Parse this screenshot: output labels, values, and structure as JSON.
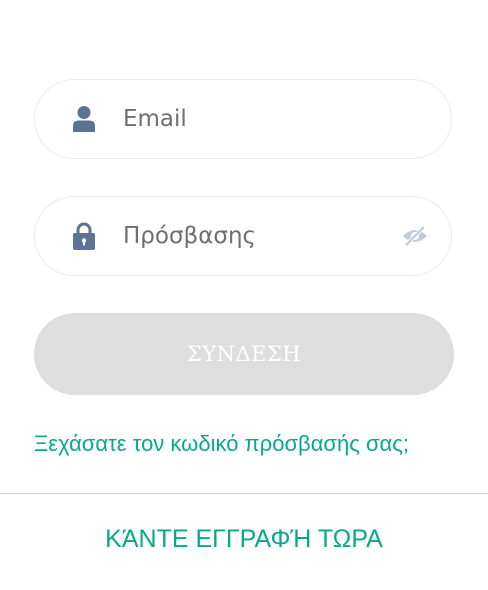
{
  "colors": {
    "accent": "#07a98b",
    "icon": "#5c7394",
    "icon_muted": "#c3cad8",
    "button_disabled_bg": "#dedede",
    "button_text": "#ffffff"
  },
  "login_form": {
    "email": {
      "icon": "user-icon",
      "value": "",
      "placeholder": "Email"
    },
    "password": {
      "icon": "lock-icon",
      "value": "",
      "placeholder": "Πρόσβασης",
      "toggle_icon": "eye-slash-icon"
    },
    "submit_label": "ΣΥΝΔΕΣΗ",
    "forgot_password_label": "Ξεχάσατε τον κωδικό πρόσβασής σας;"
  },
  "register_label": "ΚΆΝΤΕ ΕΓΓΡΑΦΉ ΤΩΡΑ"
}
